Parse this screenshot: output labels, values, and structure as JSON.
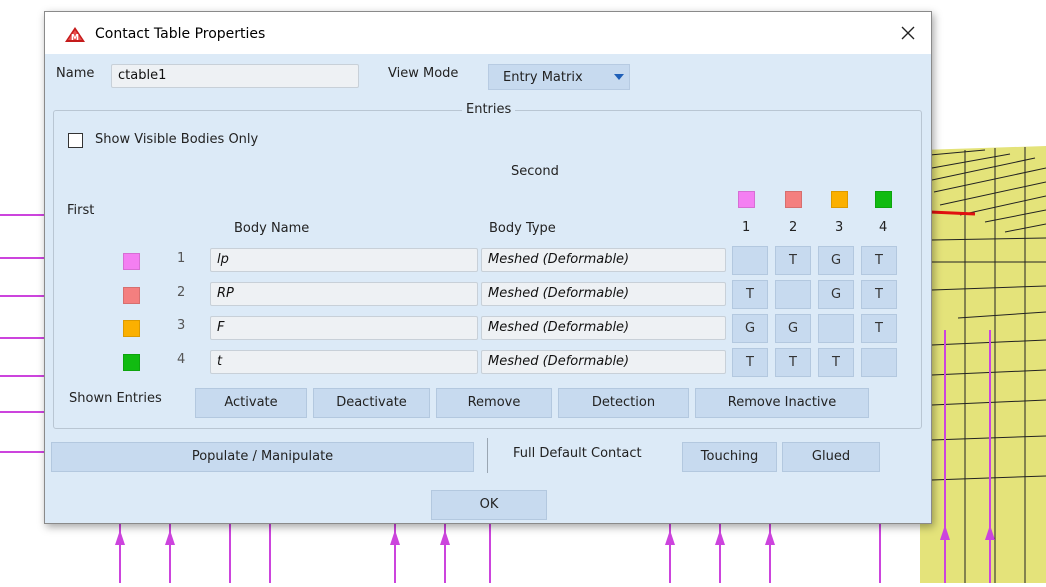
{
  "dialog": {
    "title": "Contact Table Properties",
    "close_icon": "close-icon",
    "app_icon": "mesh-app-icon"
  },
  "name": {
    "label": "Name",
    "value": "ctable1"
  },
  "view_mode": {
    "label": "View Mode",
    "value": "Entry Matrix"
  },
  "entries": {
    "legend": "Entries",
    "show_visible_label": "Show Visible Bodies Only",
    "show_visible_checked": false,
    "second_label": "Second",
    "first_label": "First",
    "body_name_header": "Body Name",
    "body_type_header": "Body Type",
    "columns": [
      "1",
      "2",
      "3",
      "4"
    ],
    "rows": [
      {
        "index": "1",
        "color": "#f47ff2",
        "name": "lp",
        "type": "Meshed (Deformable)",
        "cells": [
          "",
          "T",
          "G",
          "T"
        ]
      },
      {
        "index": "2",
        "color": "#f47f7f",
        "name": "RP",
        "type": "Meshed (Deformable)",
        "cells": [
          "T",
          "",
          "G",
          "T"
        ]
      },
      {
        "index": "3",
        "color": "#fbb000",
        "name": "F",
        "type": "Meshed (Deformable)",
        "cells": [
          "G",
          "G",
          "",
          "T"
        ]
      },
      {
        "index": "4",
        "color": "#11bb11",
        "name": "t",
        "type": "Meshed (Deformable)",
        "cells": [
          "T",
          "T",
          "T",
          ""
        ]
      }
    ],
    "shown_entries_label": "Shown Entries",
    "buttons": {
      "activate": "Activate",
      "deactivate": "Deactivate",
      "remove": "Remove",
      "detection": "Detection",
      "remove_inactive": "Remove Inactive"
    }
  },
  "populate_button": "Populate / Manipulate",
  "full_default": {
    "label": "Full Default Contact",
    "touching": "Touching",
    "glued": "Glued"
  },
  "ok_button": "OK",
  "colors": {
    "dialog_bg": "#dceaf7",
    "button_bg": "#c7daef",
    "mesh_surface": "#e4e37a",
    "arrow_magenta": "#cc44dd"
  }
}
